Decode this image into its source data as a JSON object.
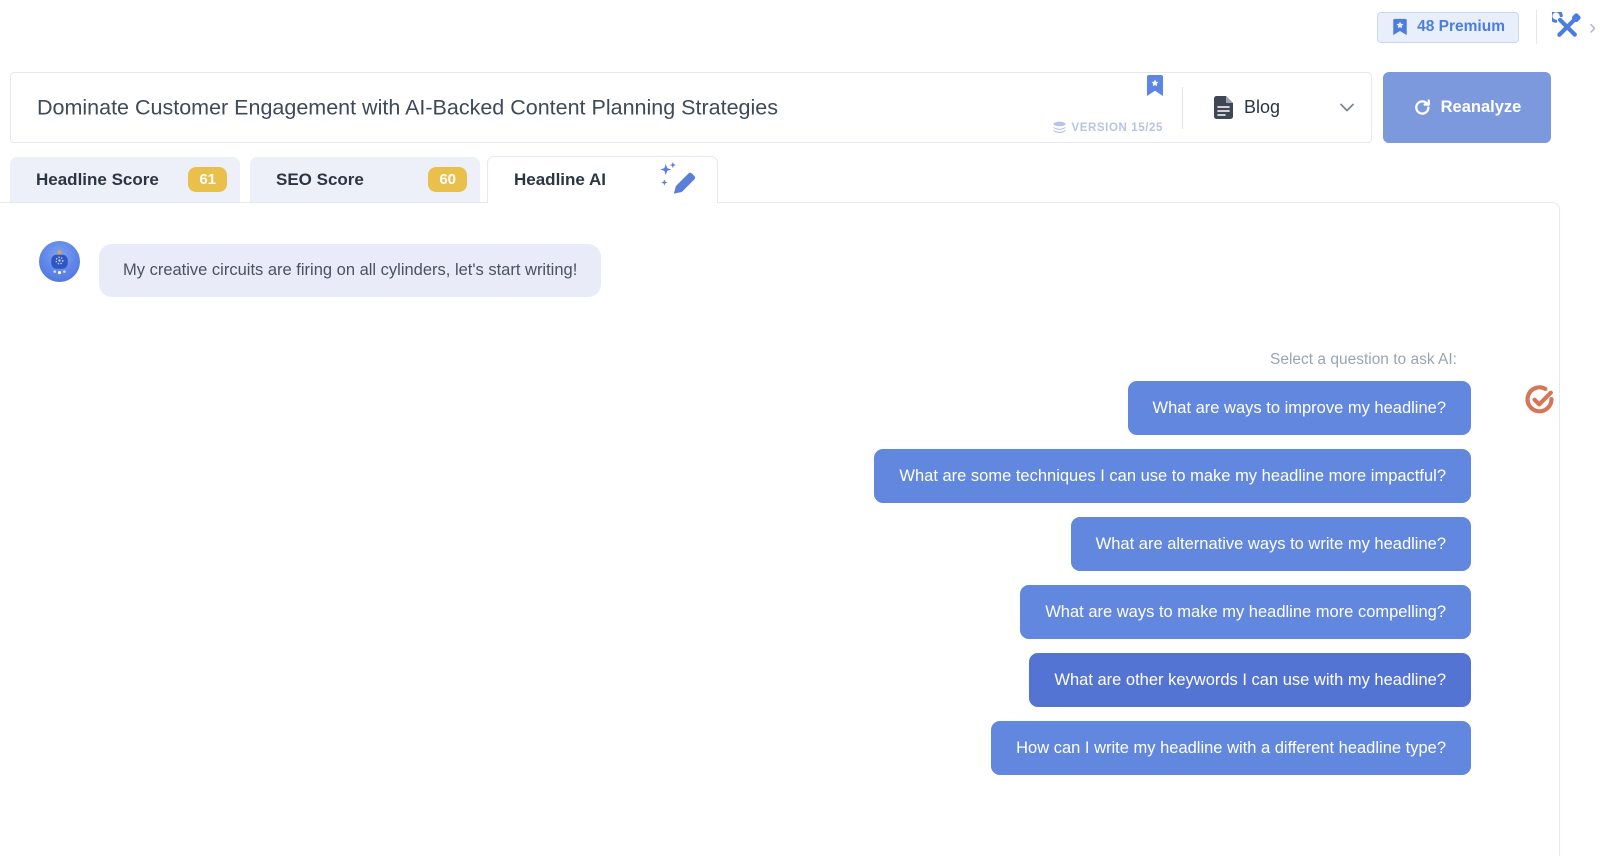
{
  "topbar": {
    "premium_label": "48 Premium",
    "chevron": "›"
  },
  "header": {
    "title": "Dominate Customer Engagement with AI-Backed Content Planning Strategies",
    "version_label": "VERSION 15/25",
    "content_type_label": "Blog",
    "reanalyze_label": "Reanalyze"
  },
  "tabs": {
    "headline_score": {
      "label": "Headline Score",
      "score": "61"
    },
    "seo_score": {
      "label": "SEO Score",
      "score": "60"
    },
    "headline_ai": {
      "label": "Headline AI"
    }
  },
  "chat": {
    "bot_message": "My creative circuits are firing on all cylinders, let's start writing!",
    "prompt_label": "Select a question to ask AI:",
    "highlighted_question_index": 4,
    "questions": [
      "What are ways to improve my headline?",
      "What are some techniques I can use to make my headline more impactful?",
      "What are alternative ways to write my headline?",
      "What are ways to make my headline more compelling?",
      "What are other keywords I can use with my headline?",
      "How can I write my headline with a different headline type?"
    ]
  },
  "icons": {
    "premium": "bookmark-star-icon",
    "topbar_tools": "tools-icon",
    "header_bookmark": "bookmark-icon",
    "version": "layers-icon",
    "content_type": "document-icon",
    "content_type_caret": "chevron-down-icon",
    "reanalyze": "refresh-icon",
    "headline_ai_tab": "pencil-sparkles-icon",
    "bot": "robot-avatar",
    "question_side": "check-circle-icon"
  },
  "colors": {
    "accent_blue": "#6187df",
    "accent_blue_dark": "#5474d3",
    "reanalyze_blue": "#7d99dd",
    "badge_yellow": "#e9c04c",
    "coral_check": "#d5765b",
    "premium_blue": "#4a7ede",
    "tab_inactive_bg": "#edf0f8",
    "bubble_bg": "#e9ecf8",
    "panel_border": "#e4e9f2"
  }
}
